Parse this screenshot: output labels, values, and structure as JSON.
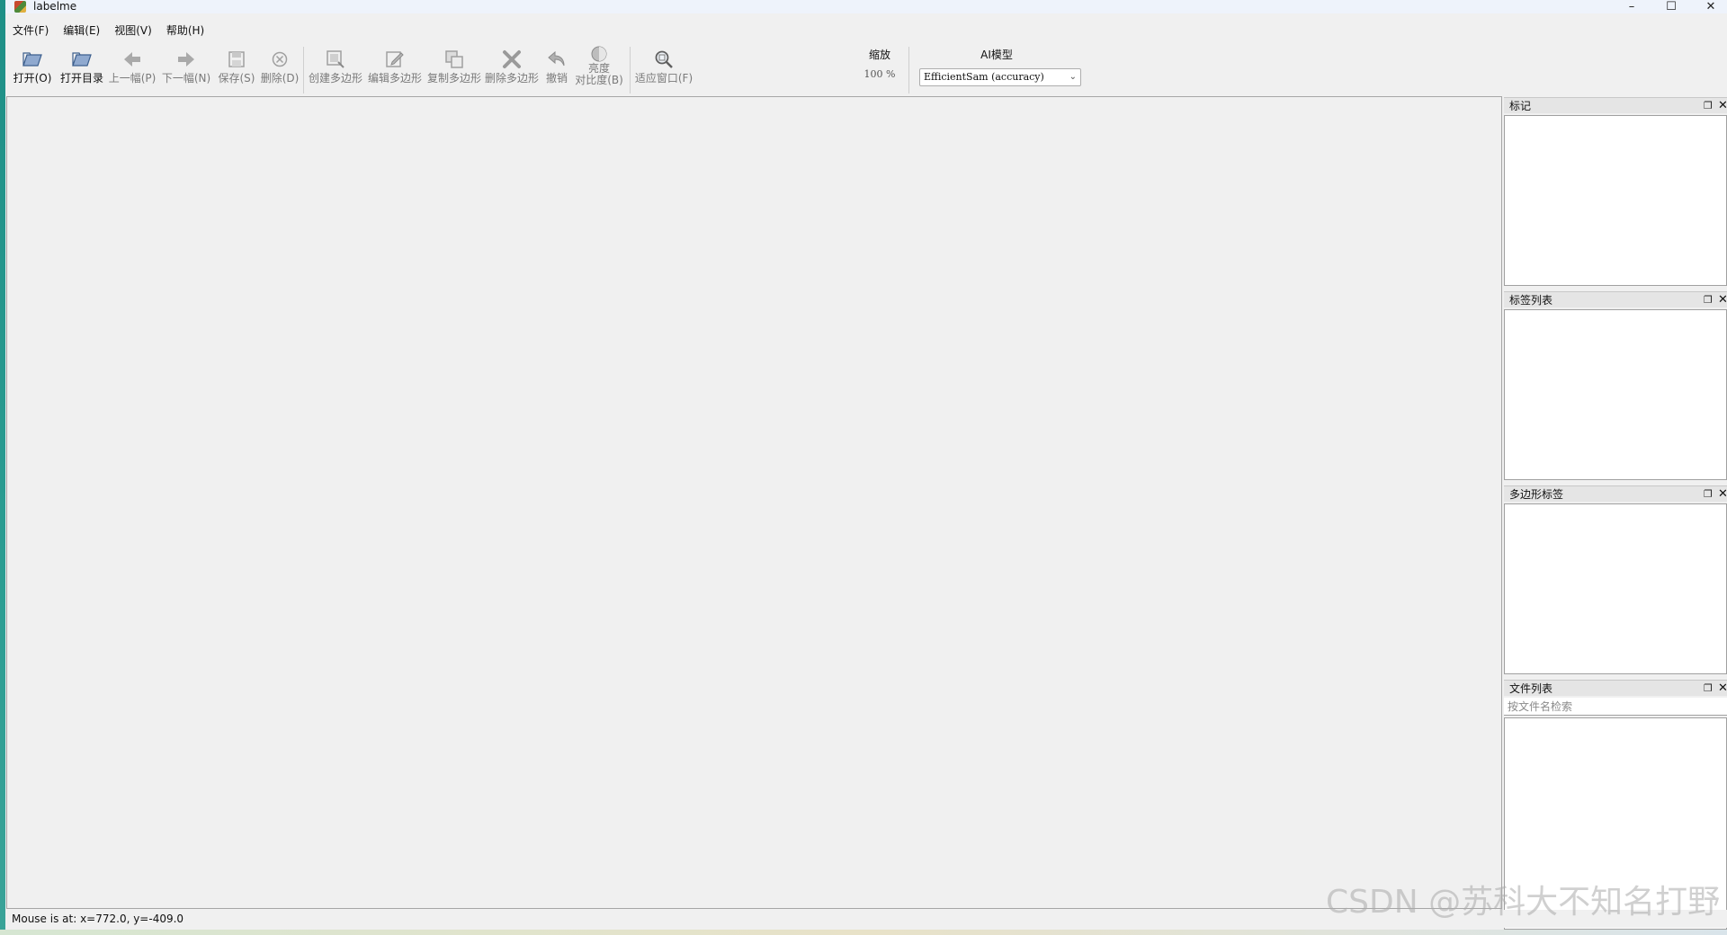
{
  "window": {
    "title": "labelme",
    "controls": {
      "minimize": "–",
      "maximize": "☐",
      "close": "✕"
    }
  },
  "menu": [
    "文件(F)",
    "编辑(E)",
    "视图(V)",
    "帮助(H)"
  ],
  "toolbar": {
    "open": {
      "label": "打开(O)",
      "icon": "open-icon"
    },
    "open_dir": {
      "label": "打开目录",
      "icon": "folder-icon"
    },
    "prev": {
      "label": "上一幅(P)",
      "icon": "arrow-left-icon"
    },
    "next": {
      "label": "下一幅(N)",
      "icon": "arrow-right-icon"
    },
    "save": {
      "label": "保存(S)",
      "icon": "save-icon"
    },
    "delete": {
      "label": "删除(D)",
      "icon": "delete-icon"
    },
    "create_polygon": {
      "label": "创建多边形",
      "icon": "create-polygon-icon"
    },
    "edit_polygon": {
      "label": "编辑多边形",
      "icon": "edit-icon"
    },
    "copy_polygon": {
      "label": "复制多边形",
      "icon": "copy-icon"
    },
    "delete_polygon": {
      "label": "删除多边形",
      "icon": "cross-icon"
    },
    "undo": {
      "label": "撤销",
      "icon": "undo-icon"
    },
    "brightness": {
      "label_line1": "亮度",
      "label_line2": "对比度(B)",
      "icon": "brightness-icon"
    },
    "fit_window": {
      "label": "适应窗口(F)",
      "icon": "zoom-fit-icon"
    },
    "zoom": {
      "label": "缩放",
      "value": "100 %"
    },
    "ai_model": {
      "label": "AI模型",
      "selected": "EfficientSam (accuracy)"
    }
  },
  "docks": {
    "flags": {
      "title": "标记"
    },
    "labels": {
      "title": "标签列表"
    },
    "polygons": {
      "title": "多边形标签"
    },
    "files": {
      "title": "文件列表",
      "search_placeholder": "按文件名检索"
    }
  },
  "status": "Mouse is at: x=772.0, y=-409.0",
  "watermark": "CSDN @苏科大不知名打野"
}
